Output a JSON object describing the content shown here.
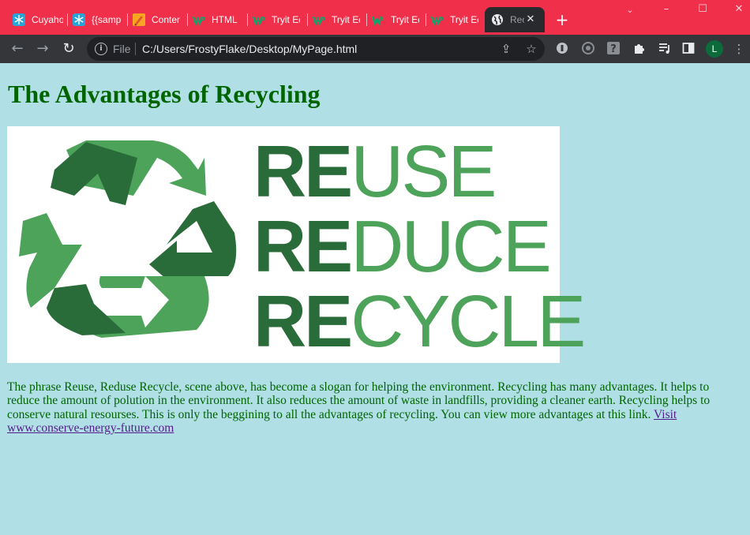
{
  "browser": {
    "tabs": [
      {
        "title": "Cuyahoga",
        "icon": "snowflake-icon"
      },
      {
        "title": "{{sample",
        "icon": "snowflake-icon"
      },
      {
        "title": "Content",
        "icon": "pencil-icon"
      },
      {
        "title": "HTML",
        "icon": "w3schools-icon"
      },
      {
        "title": "Tryit Editor",
        "icon": "w3schools-icon"
      },
      {
        "title": "Tryit Editor",
        "icon": "w3schools-icon"
      },
      {
        "title": "Tryit Editor",
        "icon": "w3schools-icon"
      },
      {
        "title": "Tryit Editor",
        "icon": "w3schools-icon"
      },
      {
        "title": "Recycling",
        "icon": "globe-icon",
        "active": true
      }
    ],
    "address": {
      "scheme_label": "File",
      "url": "C:/Users/FrostyFlake/Desktop/MyPage.html"
    },
    "profile_initial": "L",
    "tab_strip_color": "#f0304a"
  },
  "page": {
    "heading": "The Advantages of Recycling",
    "image": {
      "words": [
        {
          "prefix": "RE",
          "suffix": "USE"
        },
        {
          "prefix": "RE",
          "suffix": "DUCE"
        },
        {
          "prefix": "RE",
          "suffix": "CYCLE"
        }
      ],
      "colors": {
        "light": "#4ea35a",
        "dark": "#2a6b3a"
      }
    },
    "paragraph": "The phrase Reuse, Reduse Recycle, scene above, has become a slogan for helping the environment. Recycling has many advantages. It helps to reduce the amount of polution in the environment. It also reduces the amount of waste in landfills, providing a cleaner earth. Recycling helps to conserve natural resourses. This is only the beggining to all the advantages of recycling. You can view more advantages at this link. ",
    "link_text": "Visit www.conserve-energy-future.com",
    "background": "#b0e0e6",
    "text_color": "#006400"
  }
}
